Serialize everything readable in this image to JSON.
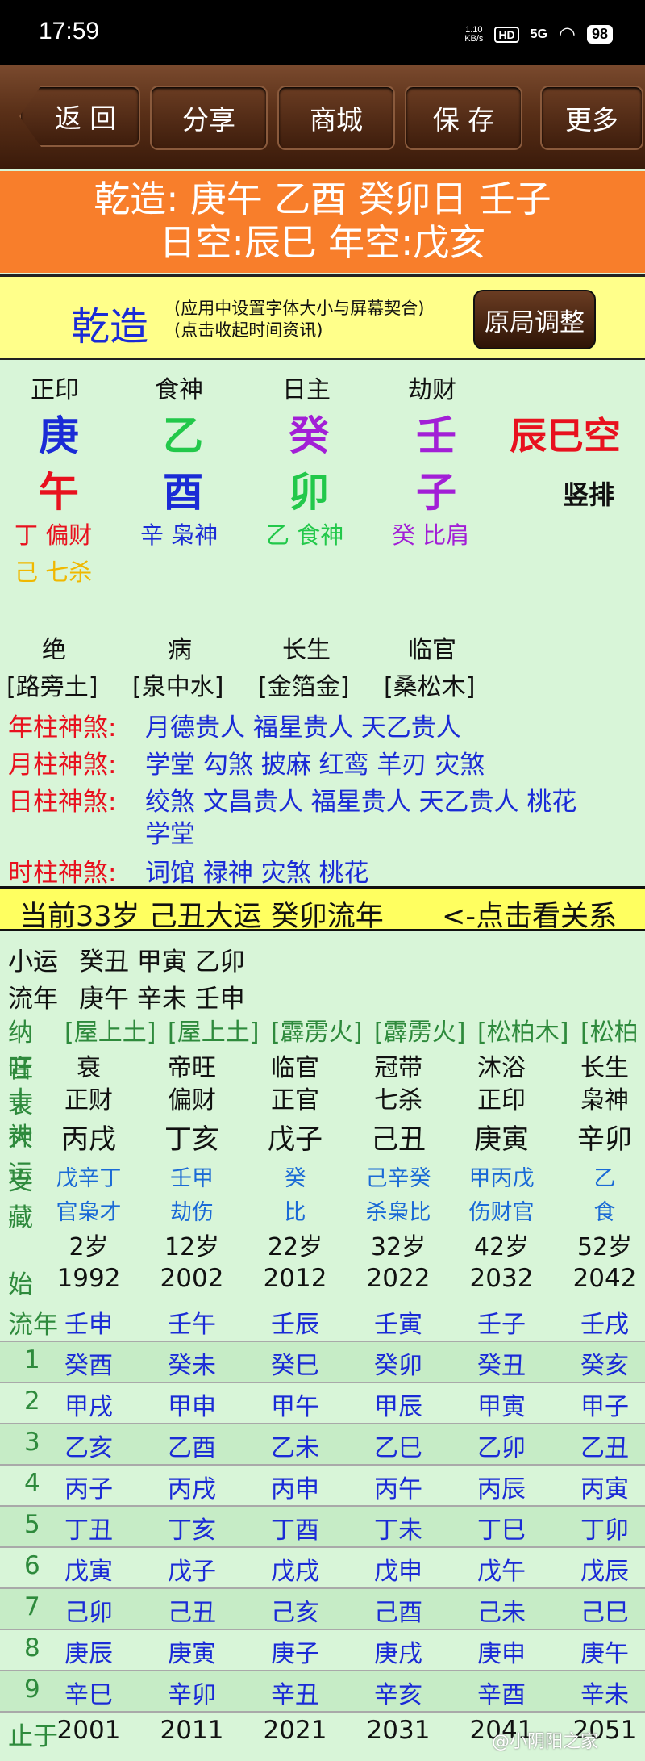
{
  "status": {
    "time": "17:59",
    "netspeed_value": "1.10",
    "netspeed_unit": "KB/s",
    "hd": "HD",
    "signal": "5G",
    "battery": "98"
  },
  "toolbar": {
    "back": "返 回",
    "share": "分享",
    "mall": "商城",
    "save": "保 存",
    "more": "更多"
  },
  "header": {
    "line1": "乾造: 庚午 乙酉 癸卯日 壬子",
    "line2": "日空:辰巳 年空:戊亥"
  },
  "yellow": {
    "title": "乾造",
    "note1": "(应用中设置字体大小与屏幕契合)",
    "note2": "(点击收起时间资讯)",
    "adjust": "原局调整"
  },
  "colors": {
    "metal": "#f0b800",
    "wood": "#22c84a",
    "water": "#1a2bd6",
    "fire": "#e8111e",
    "earth": "#9a1fc6"
  },
  "pillars": {
    "labels": [
      "正印",
      "食神",
      "日主",
      "劫财"
    ],
    "stems": [
      {
        "t": "庚",
        "c": "#1a2bd6"
      },
      {
        "t": "乙",
        "c": "#22c84a"
      },
      {
        "t": "癸",
        "c": "#a21fd6"
      },
      {
        "t": "壬",
        "c": "#a21fd6"
      }
    ],
    "branches": [
      {
        "t": "午",
        "c": "#e8111e"
      },
      {
        "t": "酉",
        "c": "#1a2bd6"
      },
      {
        "t": "卯",
        "c": "#22c84a"
      },
      {
        "t": "子",
        "c": "#a21fd6"
      }
    ],
    "kong": "辰巳空",
    "vertical": "竖排",
    "hidden1": [
      {
        "t": "丁 偏财",
        "c": "#e8111e"
      },
      {
        "t": "辛 枭神",
        "c": "#1a2bd6"
      },
      {
        "t": "乙 食神",
        "c": "#22c84a"
      },
      {
        "t": "癸 比肩",
        "c": "#a21fd6"
      }
    ],
    "hidden2": [
      {
        "t": "己 七杀",
        "c": "#f0b800"
      }
    ],
    "states": [
      "绝",
      "病",
      "长生",
      "临官"
    ],
    "nayin": [
      "[路旁土]",
      "[泉中水]",
      "[金箔金]",
      "[桑松木]"
    ]
  },
  "shensha": [
    {
      "label": "年柱神煞:",
      "value": "月德贵人  福星贵人  天乙贵人"
    },
    {
      "label": "月柱神煞:",
      "value": "学堂  勾煞  披麻  红鸾  羊刃  灾煞"
    },
    {
      "label": "日柱神煞:",
      "value": "绞煞  文昌贵人  福星贵人  天乙贵人  桃花"
    },
    {
      "label": "",
      "value": "学堂"
    },
    {
      "label": "时柱神煞:",
      "value": "词馆  禄神  灾煞  桃花"
    }
  ],
  "yun": {
    "current": "当前33岁 己丑大运 癸卯流年",
    "link": "<-点击看关系"
  },
  "xiaoyun": {
    "label": "小运",
    "value": "癸丑 甲寅 乙卯"
  },
  "liunian_top": {
    "label": "流年",
    "value": "庚午 辛未 壬申"
  },
  "dayun": {
    "nayin_label": "纳音",
    "nayin": [
      "[屋上土]",
      "[屋上土]",
      "[霹雳火]",
      "[霹雳火]",
      "[松柏木]",
      "[松柏"
    ],
    "wang_label": "旺衰",
    "wang": [
      "衰",
      "帝旺",
      "临官",
      "冠带",
      "沐浴",
      "长生"
    ],
    "shishen_label": "十神",
    "shishen": [
      "正财",
      "偏财",
      "正官",
      "七杀",
      "正印",
      "枭神"
    ],
    "dayun_label": "大运",
    "dayun": [
      "丙戌",
      "丁亥",
      "戊子",
      "己丑",
      "庚寅",
      "辛卯"
    ],
    "zhicang_label": "支藏",
    "zhicang1": [
      "戊辛丁",
      "壬甲",
      "癸",
      "己辛癸",
      "甲丙戊",
      "乙"
    ],
    "zhicang2": [
      "官枭才",
      "劫伤",
      "比",
      "杀枭比",
      "伤财官",
      "食"
    ],
    "ages": [
      "2岁",
      "12岁",
      "22岁",
      "32岁",
      "42岁",
      "52岁"
    ],
    "start_label": "始于",
    "start": [
      "1992",
      "2002",
      "2012",
      "2022",
      "2032",
      "2042"
    ]
  },
  "liunian": {
    "header_label": "流年",
    "rows": [
      {
        "label": "",
        "cells": [
          "壬申",
          "壬午",
          "壬辰",
          "壬寅",
          "壬子",
          "壬戌"
        ]
      },
      {
        "label": "1",
        "cells": [
          "癸酉",
          "癸未",
          "癸巳",
          "癸卯",
          "癸丑",
          "癸亥"
        ]
      },
      {
        "label": "2",
        "cells": [
          "甲戌",
          "甲申",
          "甲午",
          "甲辰",
          "甲寅",
          "甲子"
        ]
      },
      {
        "label": "3",
        "cells": [
          "乙亥",
          "乙酉",
          "乙未",
          "乙巳",
          "乙卯",
          "乙丑"
        ]
      },
      {
        "label": "4",
        "cells": [
          "丙子",
          "丙戌",
          "丙申",
          "丙午",
          "丙辰",
          "丙寅"
        ]
      },
      {
        "label": "5",
        "cells": [
          "丁丑",
          "丁亥",
          "丁酉",
          "丁未",
          "丁巳",
          "丁卯"
        ]
      },
      {
        "label": "6",
        "cells": [
          "戊寅",
          "戊子",
          "戊戌",
          "戊申",
          "戊午",
          "戊辰"
        ]
      },
      {
        "label": "7",
        "cells": [
          "己卯",
          "己丑",
          "己亥",
          "己酉",
          "己未",
          "己巳"
        ]
      },
      {
        "label": "8",
        "cells": [
          "庚辰",
          "庚寅",
          "庚子",
          "庚戌",
          "庚申",
          "庚午"
        ]
      },
      {
        "label": "9",
        "cells": [
          "辛巳",
          "辛卯",
          "辛丑",
          "辛亥",
          "辛酉",
          "辛未"
        ]
      }
    ],
    "end_label": "止于",
    "end": [
      "2001",
      "2011",
      "2021",
      "2031",
      "2041",
      "2051"
    ]
  },
  "watermark": "@小阴阳之家"
}
